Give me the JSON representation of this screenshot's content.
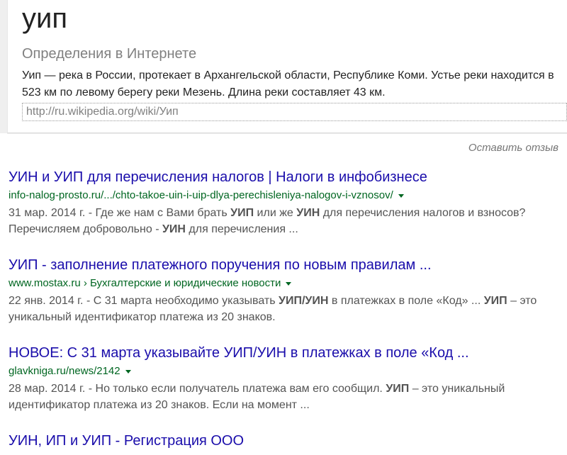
{
  "definition_card": {
    "query": "уип",
    "section_label": "Определения в Интернете",
    "definition": "Уип — река в России, протекает в Архангельской области, Республике Коми. Устье реки находится в 523 км по левому берегу реки Мезень. Длина реки составляет 43 км.",
    "source_url": "http://ru.wikipedia.org/wiki/Уип"
  },
  "feedback_link_label": "Оставить отзыв",
  "results": [
    {
      "title": "УИН и УИП для перечисления налогов | Налоги в инфобизнесе",
      "url": "info-nalog-prosto.ru/.../chto-takoe-uin-i-uip-dlya-perechisleniya-nalogov-i-vznosov/",
      "snippet": [
        {
          "t": "31 мар. 2014 г. - Где же нам с Вами брать "
        },
        {
          "t": "УИП",
          "b": true
        },
        {
          "t": " или же "
        },
        {
          "t": "УИН",
          "b": true
        },
        {
          "t": " для перечисления налогов и взносов? Перечисляем добровольно - "
        },
        {
          "t": "УИН",
          "b": true
        },
        {
          "t": " для перечисления ..."
        }
      ]
    },
    {
      "title": "УИП - заполнение платежного поручения по новым правилам ...",
      "url": "www.mostax.ru › Бухгалтерские и юридические новости",
      "snippet": [
        {
          "t": "22 янв. 2014 г. - С 31 марта необходимо указывать "
        },
        {
          "t": "УИП/УИН",
          "b": true
        },
        {
          "t": " в платежках в поле «Код» ... "
        },
        {
          "t": "УИП",
          "b": true
        },
        {
          "t": " – это уникальный идентификатор платежа из 20 знаков."
        }
      ]
    },
    {
      "title": "НОВОЕ: С 31 марта указывайте УИП/УИН в платежках в поле «Код ...",
      "url": "glavkniga.ru/news/2142",
      "snippet": [
        {
          "t": "28 мар. 2014 г. - Но только если получатель платежа вам его сообщил. "
        },
        {
          "t": "УИП",
          "b": true
        },
        {
          "t": " – это уникальный идентификатор платежа из 20 знаков. Если на момент ..."
        }
      ]
    },
    {
      "title": "УИН, ИП и УИП - Регистрация ООО",
      "url": null,
      "snippet": []
    }
  ],
  "colors": {
    "title_link_blue": "#1a0dab",
    "url_green": "#006621",
    "snippet_gray": "#545454",
    "muted_gray": "#808080",
    "page_strip_gray": "#efefef"
  }
}
